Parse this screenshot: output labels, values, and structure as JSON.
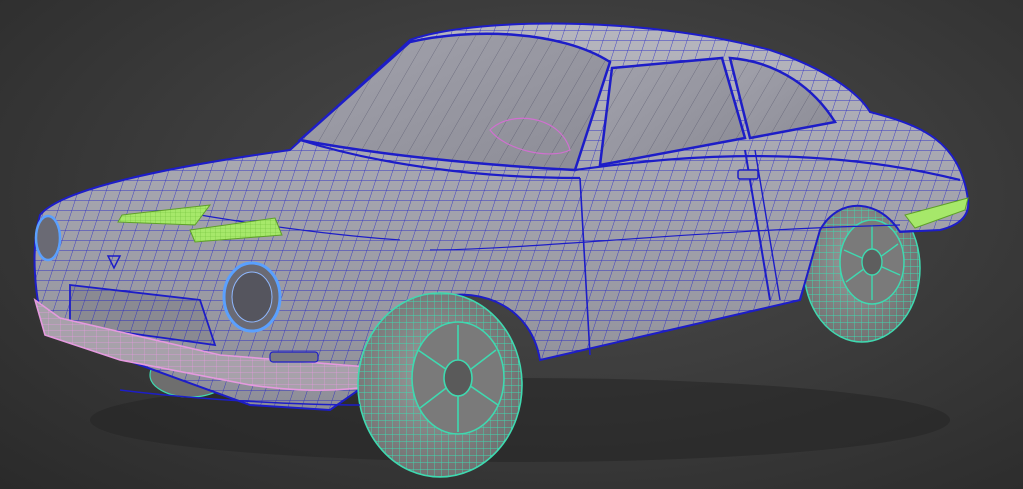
{
  "viewport": {
    "label": "",
    "background": "#3a3a3a"
  },
  "model": {
    "subject": "",
    "colors": {
      "body_wire": "#1d1dc8",
      "body_fill": "#a8a8b0",
      "glass_fill": "#9a9aa6",
      "wheel_wire": "#3fd9b0",
      "wheel_fill": "#8a8a8a",
      "bumper_wire": "#e59adf",
      "vent_fill": "#a6e86a",
      "headlight_ring": "#5aa0ff",
      "interior_wire": "#d070d0"
    }
  }
}
